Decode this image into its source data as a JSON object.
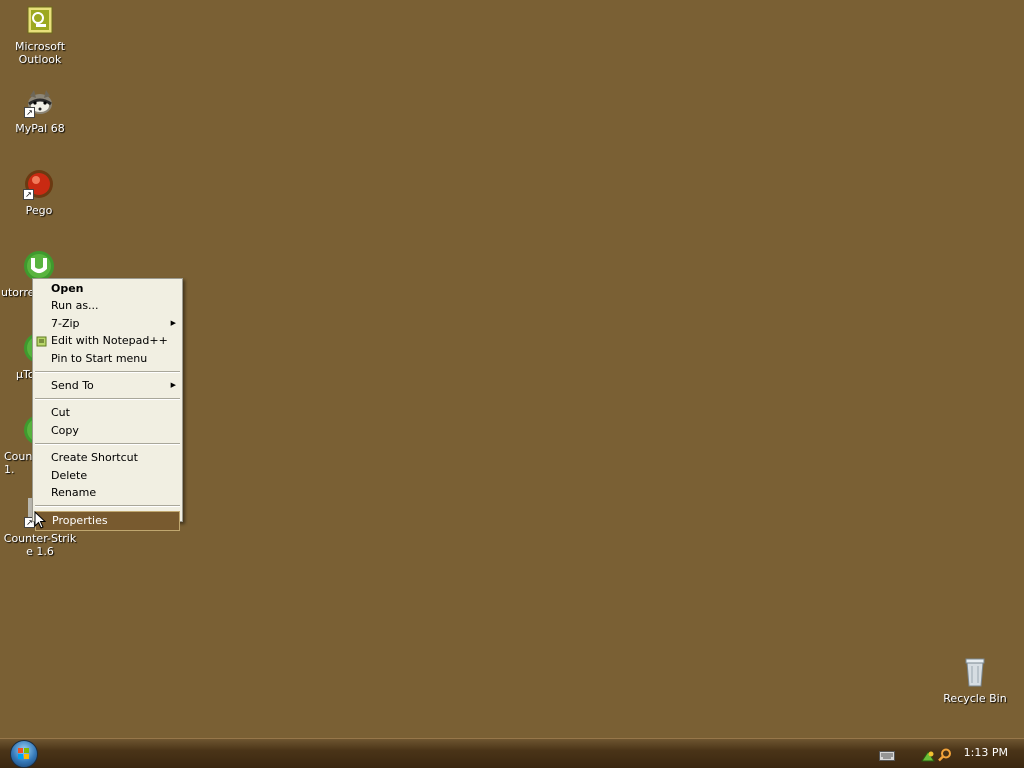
{
  "desktop": {
    "background_color": "#7a6034",
    "icons": [
      {
        "label": "Microsoft Outlook",
        "icon": "outlook-icon"
      },
      {
        "label": "MyPal 68",
        "icon": "mypal-icon"
      },
      {
        "label": "Pego",
        "icon": "pego-icon"
      },
      {
        "label": "utorre",
        "icon": "utorrent-icon"
      },
      {
        "label": "µTo",
        "icon": "utorrent-icon"
      },
      {
        "label": "Coun 1.",
        "icon": "utorrent-icon"
      },
      {
        "label": "Counter-Strik e 1.6",
        "icon": "counter-strike-icon"
      }
    ],
    "recycle_bin": {
      "label": "Recycle Bin",
      "icon": "recycle-bin-icon"
    }
  },
  "context_menu": {
    "items": [
      {
        "label": "Open",
        "bold": true
      },
      {
        "label": "Run as..."
      },
      {
        "label": "7-Zip",
        "submenu": true
      },
      {
        "label": "Edit with Notepad++",
        "icon": "notepadpp-icon"
      },
      {
        "label": "Pin to Start menu"
      },
      {
        "label": "Send To",
        "submenu": true
      },
      {
        "label": "Cut"
      },
      {
        "label": "Copy"
      },
      {
        "label": "Create Shortcut"
      },
      {
        "label": "Delete"
      },
      {
        "label": "Rename"
      },
      {
        "label": "Properties",
        "highlighted": true
      }
    ],
    "highlight_color": "#785a2f"
  },
  "taskbar": {
    "start_button_icon": "windows-orb-icon",
    "tray_icons": [
      "keyboard-icon",
      "network-icon",
      "search-icon"
    ],
    "clock": "1:13 PM"
  }
}
